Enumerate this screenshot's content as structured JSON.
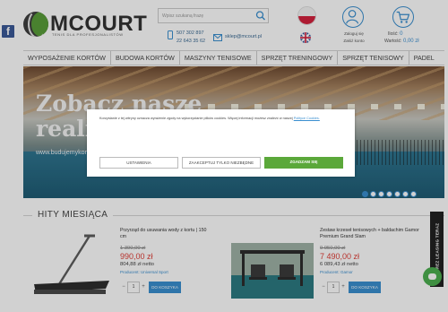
{
  "header": {
    "facebook_glyph": "f",
    "logo_text": "MCOURT",
    "logo_tagline": "TENIS DLA PROFESJONALISTÓW",
    "search_placeholder": "Wpisz szukaną frazę",
    "phone1": "507 302 897",
    "phone2": "22 643 35 62",
    "email": "sklep@mcourt.pl",
    "login_line1": "Zaloguj się",
    "login_line2": "Załóż konto",
    "cart_qty_label": "Ilość:",
    "cart_qty_value": "0",
    "cart_value_label": "Wartość:",
    "cart_value_value": "0,00 zł"
  },
  "nav": {
    "items": [
      "WYPOSAŻENIE KORTÓW",
      "BUDOWA KORTÓW",
      "MASZYNY TENISOWE",
      "SPRZĘT TRENINGOWY",
      "SPRZĘT TENISOWY",
      "PADEL"
    ]
  },
  "hero": {
    "title_line1": "Zobacz nasze",
    "title_line2": "realizacje",
    "url_text": "www.budujemykorty.pl",
    "slides_total": 7,
    "slide_active": 1
  },
  "cookie": {
    "text": "Korzystanie z tej witryny oznacza wyrażenie zgody na wykorzystanie plików cookies. Więcej informacji możesz znaleźć w naszej",
    "link": "Polityce Cookies.",
    "btn_settings": "USTAWIENIA",
    "btn_necessary": "ZAAKCEPTUJ TYLKO NIEZBĘDNE",
    "btn_agree": "ZGADZAM SIĘ"
  },
  "section_title": "HITY MIESIĄCA",
  "products": [
    {
      "name": "Przyrząd do usuwania wody z kortu | 150 cm",
      "old_price": "1 390,00 zł",
      "price": "990,00 zł",
      "net_price": "804,88 zł netto",
      "producer_label": "Producent:",
      "producer": "Universal Sport",
      "qty": "1",
      "add_label": "DO KOSZYKA"
    },
    {
      "name": "Zestaw krzeseł tenisowych + baldachim Gamor Premium Grand Slam",
      "old_price": "9 950,00 zł",
      "price": "7 490,00 zł",
      "net_price": "6 089,43 zł netto",
      "producer_label": "Producent:",
      "producer": "Gamor",
      "qty": "1",
      "add_label": "DO KOSZYKA"
    }
  ],
  "side_tab": "REZ LEASING TERAZ",
  "colors": {
    "accent": "#3a8fd0",
    "price": "#e0403a",
    "agree": "#5ba83a"
  }
}
